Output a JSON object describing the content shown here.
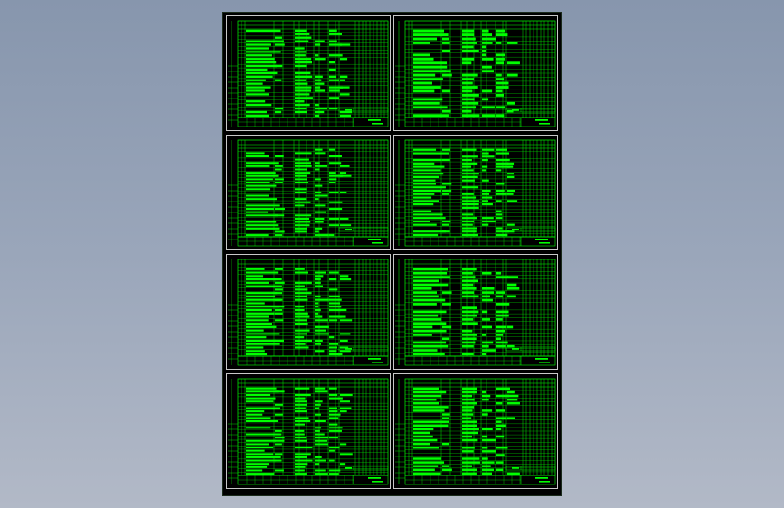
{
  "viewport": {
    "background_top": "#8796ad",
    "background_bottom": "#b2b9c7"
  },
  "drawing": {
    "sheet_color": "#000000",
    "line_color": "#00ff00",
    "frame_color": "#c8c8c8",
    "panels": [
      {
        "id": "table-sheet-1",
        "rows": 25,
        "right_blank": false
      },
      {
        "id": "table-sheet-2",
        "rows": 22,
        "right_blank": false
      },
      {
        "id": "table-sheet-3",
        "rows": 27,
        "right_blank": false
      },
      {
        "id": "table-sheet-4",
        "rows": 26,
        "right_blank": false
      },
      {
        "id": "table-sheet-5",
        "rows": 26,
        "right_blank": false
      },
      {
        "id": "table-sheet-6",
        "rows": 23,
        "right_blank": false
      },
      {
        "id": "table-sheet-7",
        "rows": 27,
        "right_blank": false
      },
      {
        "id": "table-sheet-8",
        "rows": 24,
        "right_blank": false
      }
    ]
  }
}
